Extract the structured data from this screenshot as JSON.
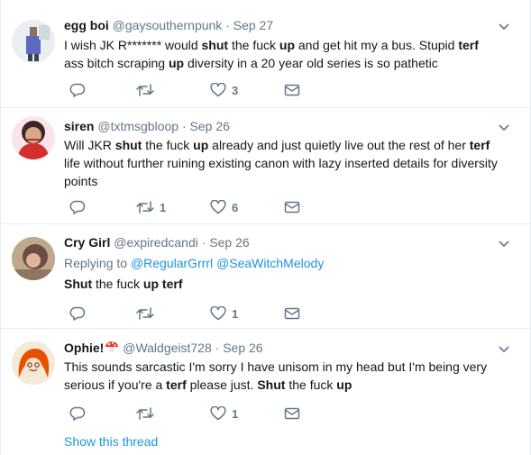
{
  "tweets": [
    {
      "name": "egg boi",
      "handle": "@gaysouthernpunk",
      "dot": "·",
      "date": "Sep 27",
      "text_parts": [
        "I wish JK R******* would ",
        "shut",
        " the fuck ",
        "up",
        " and get hit my a bus. Stupid ",
        "terf",
        " ass bitch scraping ",
        "up",
        " diversity in a 20 year old series is so pathetic"
      ],
      "actions": {
        "reply": "",
        "retweet": "",
        "like": "3"
      }
    },
    {
      "name": "siren",
      "handle": "@txtmsgbloop",
      "dot": "·",
      "date": "Sep 26",
      "text_parts": [
        "Will JKR ",
        "shut",
        " the fuck ",
        "up",
        " already and just quietly live out the rest of her ",
        "terf",
        " life without further ruining existing canon with lazy inserted details for diversity points"
      ],
      "actions": {
        "reply": "",
        "retweet": "1",
        "like": "6"
      }
    },
    {
      "name": "Cry Girl",
      "handle": "@expiredcandi",
      "dot": "·",
      "date": "Sep 26",
      "replying_to_label": "Replying to",
      "replying_to_1": "@RegularGrrrl",
      "replying_to_2": "@SeaWitchMelody",
      "text_parts": [
        "Shut",
        " the fuck ",
        "up",
        " ",
        "terf"
      ],
      "actions": {
        "reply": "",
        "retweet": "",
        "like": "1"
      }
    },
    {
      "name": "Ophie!",
      "handle": "@Waldgeist728",
      "dot": "·",
      "date": "Sep 26",
      "text_parts": [
        "This sounds sarcastic I'm sorry I have unisom in my head but I'm being very serious if you're a ",
        "terf",
        " please just. ",
        "Shut",
        " the fuck ",
        "up"
      ],
      "actions": {
        "reply": "",
        "retweet": "",
        "like": "1"
      },
      "show_thread": "Show this thread"
    }
  ],
  "colors": {
    "text": "#14171a",
    "secondary": "#657786",
    "link": "#1b95e0",
    "divider": "#e6ecf0"
  },
  "icons": {
    "reply": "reply-icon",
    "retweet": "retweet-icon",
    "like": "heart-icon",
    "dm": "envelope-icon",
    "menu": "chevron-down-icon",
    "emoji": "mushroom-emoji-icon"
  }
}
